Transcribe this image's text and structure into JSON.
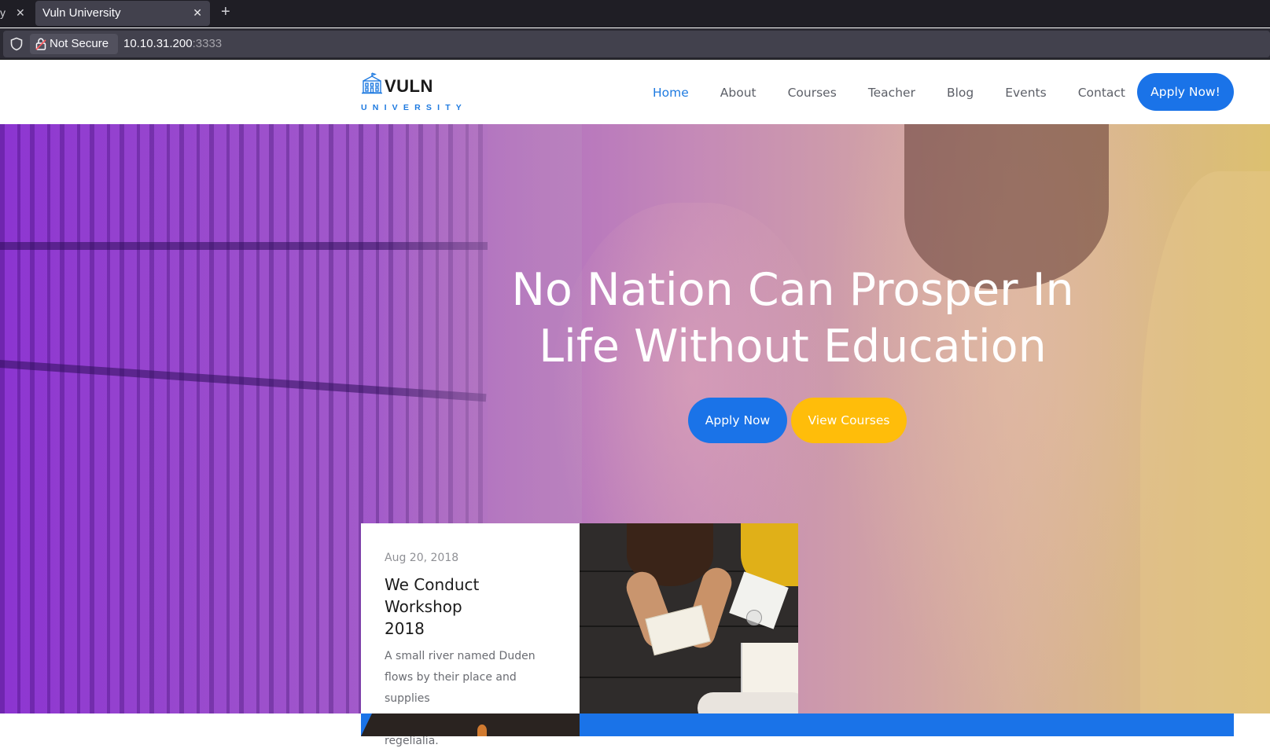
{
  "browser": {
    "prev_tab_title": "y",
    "tab_title": "Vuln University",
    "security_label": "Not Secure",
    "url_host": "10.10.31.200",
    "url_port": ":3333"
  },
  "site": {
    "logo_title": "VULN",
    "logo_subtitle": "UNIVERSITY",
    "nav": [
      {
        "label": "Home",
        "active": true
      },
      {
        "label": "About",
        "active": false
      },
      {
        "label": "Courses",
        "active": false
      },
      {
        "label": "Teacher",
        "active": false
      },
      {
        "label": "Blog",
        "active": false
      },
      {
        "label": "Events",
        "active": false
      },
      {
        "label": "Contact",
        "active": false
      }
    ],
    "apply_button": "Apply Now!"
  },
  "hero": {
    "headline_line1": "No Nation Can Prosper In",
    "headline_line2": "Life Without Education",
    "apply_label": "Apply Now",
    "courses_label": "View Courses"
  },
  "event": {
    "date": "Aug 20, 2018",
    "title_line1": "We Conduct Workshop",
    "title_line2": "2018",
    "desc_line1": "A small river named Duden",
    "desc_line2": "flows by their place and supplies",
    "desc_line3": "it with the necessary regelialia."
  },
  "colors": {
    "brand_blue": "#1a73e8",
    "accent_yellow": "#ffbd0a",
    "hero_purple": "#8a2fd0"
  }
}
